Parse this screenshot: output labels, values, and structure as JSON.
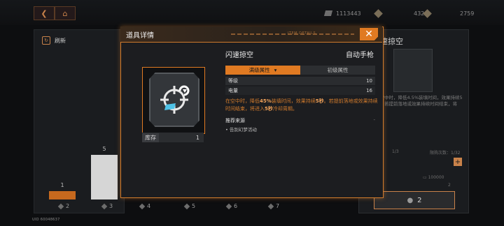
{
  "topbar": {
    "currencies": [
      {
        "icon": "stack-icon",
        "value": "1113443"
      },
      {
        "icon": "gem-icon",
        "value": "4320"
      },
      {
        "icon": "crystal-icon",
        "value": "2759"
      }
    ]
  },
  "left_panel": {
    "refresh_label": "刷新"
  },
  "bars": [
    {
      "value": "1",
      "count": "2",
      "color": "#c6691e"
    },
    {
      "value": "5",
      "count": "3",
      "color": "#d6d6d6"
    },
    {
      "value": "",
      "count": "4",
      "color": ""
    },
    {
      "value": "",
      "count": "5",
      "color": ""
    },
    {
      "value": "",
      "count": "6",
      "color": ""
    },
    {
      "value": "",
      "count": "7",
      "color": ""
    }
  ],
  "uid": "UID 60048637",
  "right_panel": {
    "title": "闪速掠空",
    "desc": "在空中时，降低4.5%装填时间，效果持续5秒。若提前落地或效果持续时间结束，将",
    "page": "1/3",
    "limit": "限购次数：1/32",
    "price": "100000",
    "unit_price": "2",
    "buy_count": "2"
  },
  "modal": {
    "title": "道具详情",
    "deco_text": "ITEM DETAILS",
    "item_name": "闪速掠空",
    "item_type": "自动手枪",
    "tab_active": "满级属性",
    "tab_inactive": "初级属性",
    "stats": [
      {
        "label": "等级",
        "value": "10"
      },
      {
        "label": "电量",
        "value": "16"
      }
    ],
    "desc_parts": [
      "在空中时，降低",
      "45%",
      "装填时间，效果持续",
      "5秒",
      "。若提前落地或效果持续时间结束，将进入",
      "5秒",
      "冷却周期。"
    ],
    "source_title": "推荐来源",
    "source_items": [
      "告别幻梦活动"
    ],
    "stock_label": "库存",
    "stock_value": "1"
  }
}
